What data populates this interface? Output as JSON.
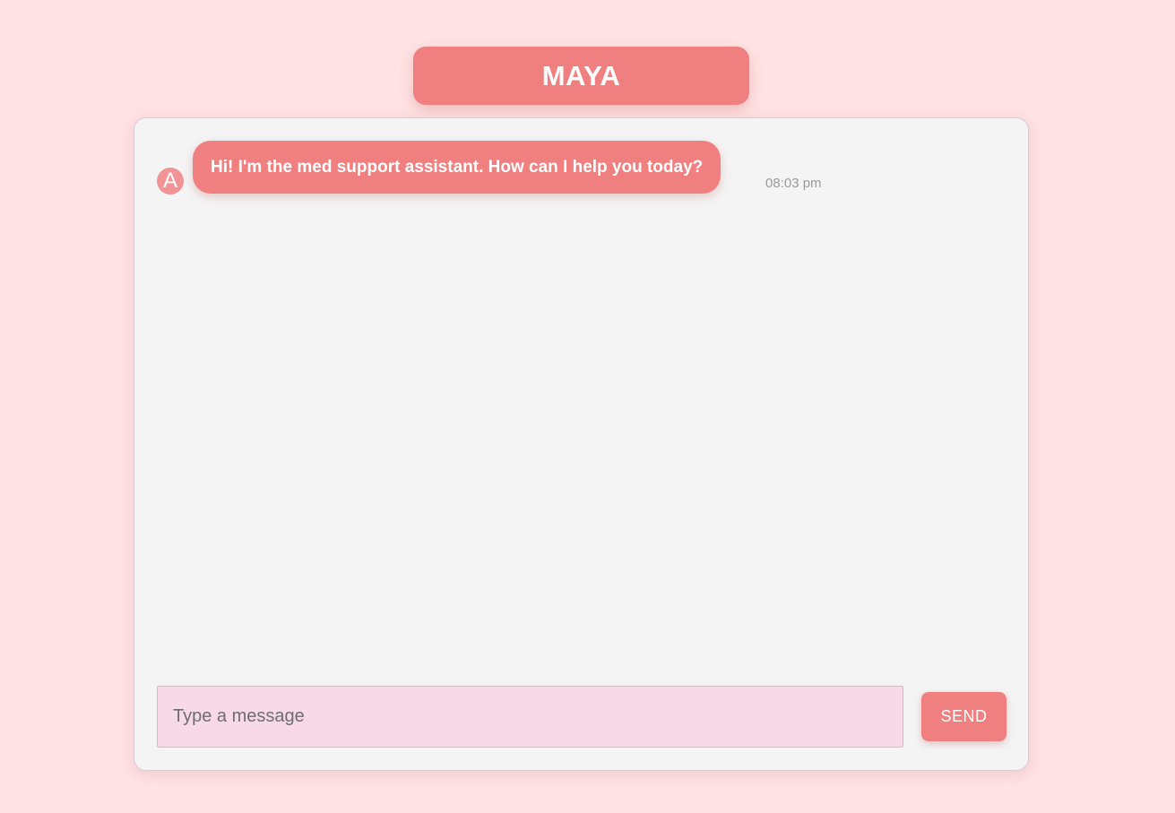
{
  "app": {
    "title": "MAYA"
  },
  "colors": {
    "background": "#ffe2e3",
    "accent": "#f08080",
    "panel": "#f4f4f4",
    "input_background": "#f7d9e7"
  },
  "messages": [
    {
      "sender_initial": "A",
      "text": "Hi! I'm the med support assistant. How can I help you today?",
      "time": "08:03 pm"
    }
  ],
  "composer": {
    "placeholder": "Type a message",
    "value": "",
    "send_label": "SEND"
  }
}
